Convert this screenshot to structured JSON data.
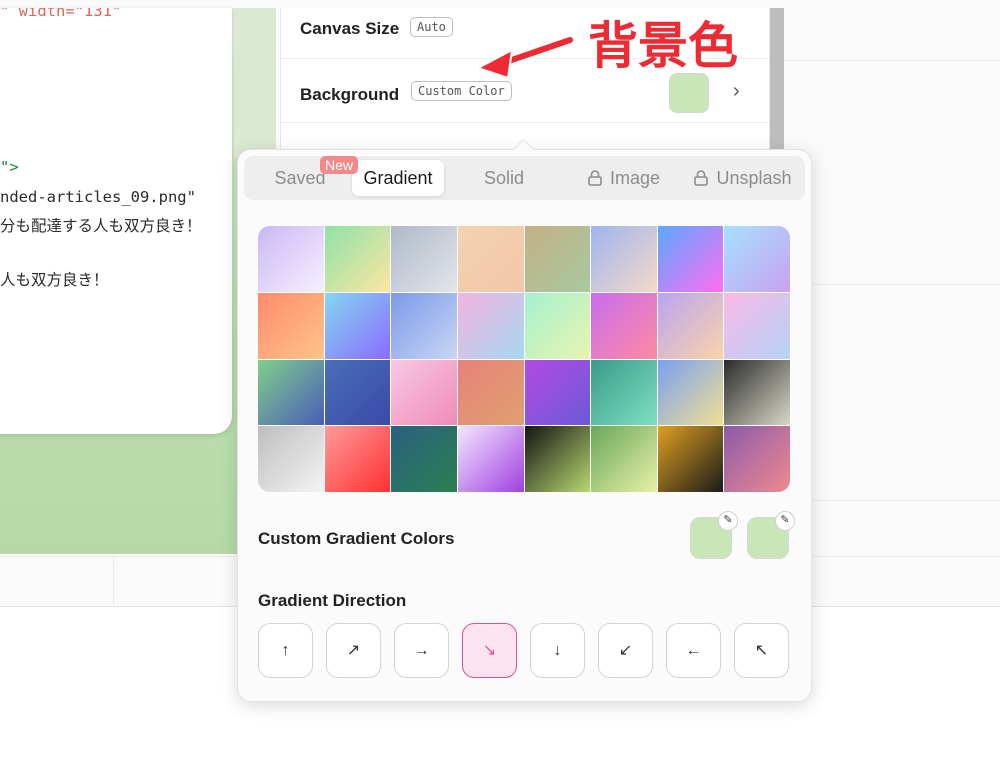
{
  "code_editor": {
    "lines": [
      {
        "pre": "\" ",
        "attr": "width",
        "eq": "=\"131\""
      },
      {
        "text": "\">"
      },
      {
        "text": "nded-articles_09.png\""
      },
      {
        "text": "分も配達する人も双方良き！"
      },
      {
        "text": "人も双方良き！"
      }
    ]
  },
  "settings": {
    "canvas_size_label": "Canvas Size",
    "canvas_size_value": "Auto",
    "background_label": "Background",
    "background_value": "Custom Color",
    "background_color": "#c8e6b8"
  },
  "annotation": {
    "label": "背景色",
    "color": "#ee2a33"
  },
  "popover": {
    "tabs": [
      {
        "label": "Saved",
        "locked": false
      },
      {
        "label": "Gradient",
        "locked": false,
        "active": true
      },
      {
        "label": "Solid",
        "locked": false
      },
      {
        "label": "Image",
        "locked": true
      },
      {
        "label": "Unsplash",
        "locked": true
      }
    ],
    "new_badge": "New",
    "gradients": [
      "linear-gradient(135deg,#c9b8f5,#f7f0ff)",
      "linear-gradient(135deg,#8fe1a8,#fde6a1)",
      "linear-gradient(135deg,#aeb9c9,#e3e6ea)",
      "linear-gradient(135deg,#f3d3b0,#f1c7a8)",
      "linear-gradient(135deg,#c4b085,#a8c9a0)",
      "linear-gradient(135deg,#9fb4f0,#f4d9c8)",
      "linear-gradient(135deg,#5aa8ff,#ff6ef2)",
      "linear-gradient(135deg,#a7e0ff,#c9a2f0)",
      "linear-gradient(135deg,#ff8b6b,#ffc48a)",
      "linear-gradient(135deg,#86d6f0,#8a6bff)",
      "linear-gradient(135deg,#7a9ae8,#c9d6f5)",
      "linear-gradient(135deg,#f3b4e0,#a6d8f0)",
      "linear-gradient(135deg,#a6f0d0,#e8f5b0)",
      "linear-gradient(135deg,#c86df0,#ff8aa0)",
      "linear-gradient(135deg,#b9a4f2,#fbd3a8)",
      "linear-gradient(135deg,#f9b8e6,#b5d2f7)",
      "linear-gradient(135deg,#7fcf8a,#4a5db8)",
      "linear-gradient(135deg,#4a6fb8,#3b4aa8)",
      "linear-gradient(135deg,#f7c9e3,#f08ab8)",
      "linear-gradient(135deg,#e8827a,#e0a070)",
      "linear-gradient(135deg,#b44ae0,#6a5ad8)",
      "linear-gradient(135deg,#3a9a8a,#7fe0c0)",
      "linear-gradient(135deg,#7aa0f0,#f0e090)",
      "linear-gradient(135deg,#2b2b2b,#d8d8c8)",
      "linear-gradient(135deg,#bdbdbd,#f5f5f5)",
      "linear-gradient(135deg,#ff9a9a,#ff3030)",
      "linear-gradient(135deg,#2a6080,#2a8050)",
      "linear-gradient(135deg,#f4e6ff,#a040e0)",
      "linear-gradient(135deg,#141414,#b8d870)",
      "linear-gradient(135deg,#6aa85a,#e8f0a8)",
      "linear-gradient(135deg,#e0a020,#1a1a1a)",
      "linear-gradient(135deg,#8a5aa8,#f08a90)"
    ],
    "custom_colors_label": "Custom Gradient Colors",
    "custom_color_1": "#c8e6b8",
    "custom_color_2": "#c8e6b8",
    "direction_label": "Gradient Direction",
    "directions": [
      {
        "glyph": "↑",
        "name": "up"
      },
      {
        "glyph": "↗",
        "name": "up-right"
      },
      {
        "glyph": "→",
        "name": "right"
      },
      {
        "glyph": "↘",
        "name": "down-right",
        "active": true
      },
      {
        "glyph": "↓",
        "name": "down"
      },
      {
        "glyph": "↙",
        "name": "down-left"
      },
      {
        "glyph": "←",
        "name": "left"
      },
      {
        "glyph": "↖",
        "name": "up-left"
      }
    ],
    "accent_color": "#e04f9a"
  }
}
